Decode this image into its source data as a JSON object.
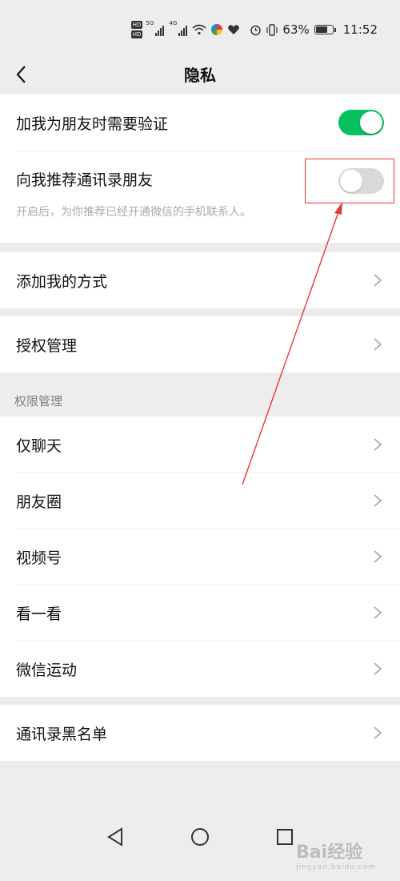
{
  "status_bar": {
    "hd1": "HD",
    "hd2": "HD",
    "net1": "5G",
    "net2": "4G",
    "battery": "63%",
    "time": "11:52"
  },
  "nav": {
    "title": "隐私"
  },
  "groups": {
    "verify": {
      "label": "加我为朋友时需要验证",
      "enabled": true
    },
    "recommend": {
      "label": "向我推荐通讯录朋友",
      "enabled": false,
      "hint": "开启后，为你推荐已经开通微信的手机联系人。"
    },
    "add_methods": {
      "label": "添加我的方式"
    },
    "auth": {
      "label": "授权管理"
    }
  },
  "permissions": {
    "header": "权限管理",
    "items": [
      "仅聊天",
      "朋友圈",
      "视频号",
      "看一看",
      "微信运动"
    ]
  },
  "blacklist": {
    "label": "通讯录黑名单"
  },
  "watermark": {
    "brand": "Bai经验",
    "url": "jingyan.baidu.com"
  },
  "colors": {
    "toggle_on": "#07c160",
    "toggle_off": "#d9d9d9",
    "annotation": "#e53935"
  },
  "icons": [
    "back-arrow-icon",
    "chevron-right-icon",
    "wifi-icon",
    "battery-icon",
    "alarm-icon",
    "vibrate-icon",
    "heart-icon"
  ]
}
